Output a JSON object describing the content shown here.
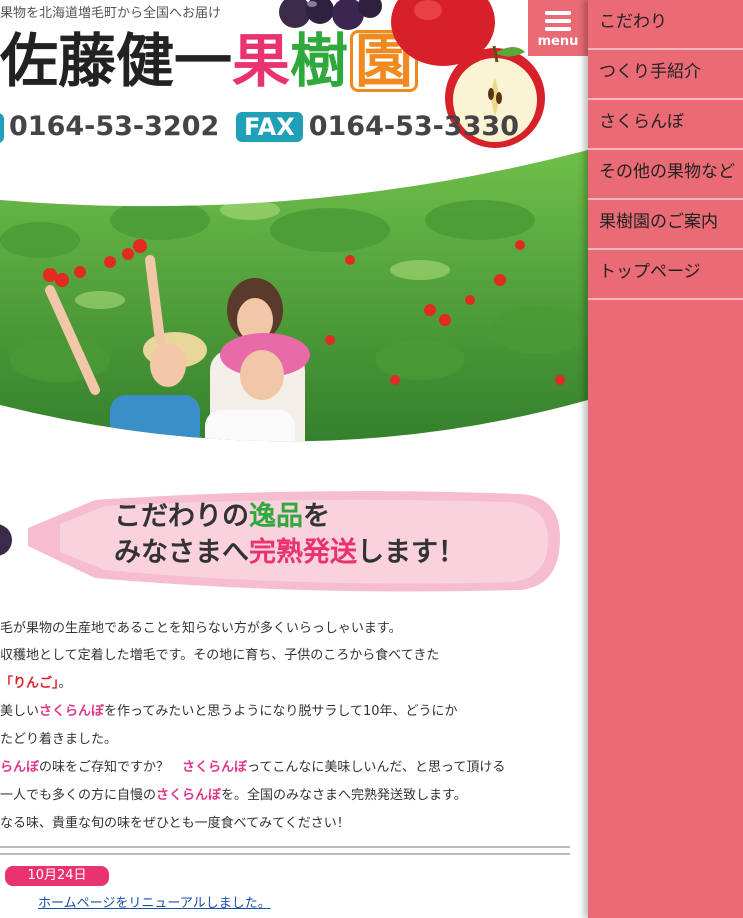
{
  "header": {
    "tagline": "果物を北海道増毛町から全国へお届け",
    "logo": {
      "part1": "佐藤健一",
      "part2": "果",
      "part3": "樹",
      "part4": "園"
    },
    "tel_number": "0164-53-3202",
    "fax_label": "FAX",
    "fax_number": "0164-53-3330"
  },
  "menu_button": {
    "label": "menu",
    "icon": "hamburger-icon"
  },
  "sidebar": {
    "items": [
      {
        "label": "こだわり"
      },
      {
        "label": "つくり手紹介"
      },
      {
        "label": "さくらんぼ"
      },
      {
        "label": "その他の果物など"
      },
      {
        "label": "果樹園のご案内"
      },
      {
        "label": "トップページ"
      }
    ]
  },
  "catch": {
    "line1_a": "こだわりの",
    "line1_b": "逸品",
    "line1_c": "を",
    "line2_a": "みなさまへ",
    "line2_b": "完熟発送",
    "line2_c": "します！"
  },
  "intro": {
    "line1": "毛が果物の生産地であることを知らない方が多くいらっしゃいます。",
    "line2": "収穫地として定着した増毛です。その地に育ち、子供のころから食べてきた",
    "line3_hl": "「りんご」",
    "line3_rest": "。",
    "line4_a": "美しい",
    "line4_hl": "さくらんぼ",
    "line4_b": "を作ってみたいと思うようになり脱サラして10年、どうにか",
    "line5": "たどり着きました。",
    "line6_hl1": "らんぼ",
    "line6_a": "の味をご存知ですか？　",
    "line6_hl2": "さくらんぼ",
    "line6_b": "ってこんなに美味しいんだ、と思って頂ける",
    "line7_a": "一人でも多くの方に自慢の",
    "line7_hl": "さくらんぼ",
    "line7_b": "を。全国のみなさまへ完熟発送致します。",
    "line8": "なる味、貴重な旬の味をぜひとも一度食べてみてください！"
  },
  "news": {
    "date": "10月24日",
    "link": "ホームページをリニューアルしました。"
  },
  "colors": {
    "sidebar_bg": "#ea6a75",
    "accent_pink": "#e8336e",
    "accent_green": "#2fa83c",
    "accent_orange": "#f08a1e",
    "badge_teal": "#1fa0b8"
  }
}
